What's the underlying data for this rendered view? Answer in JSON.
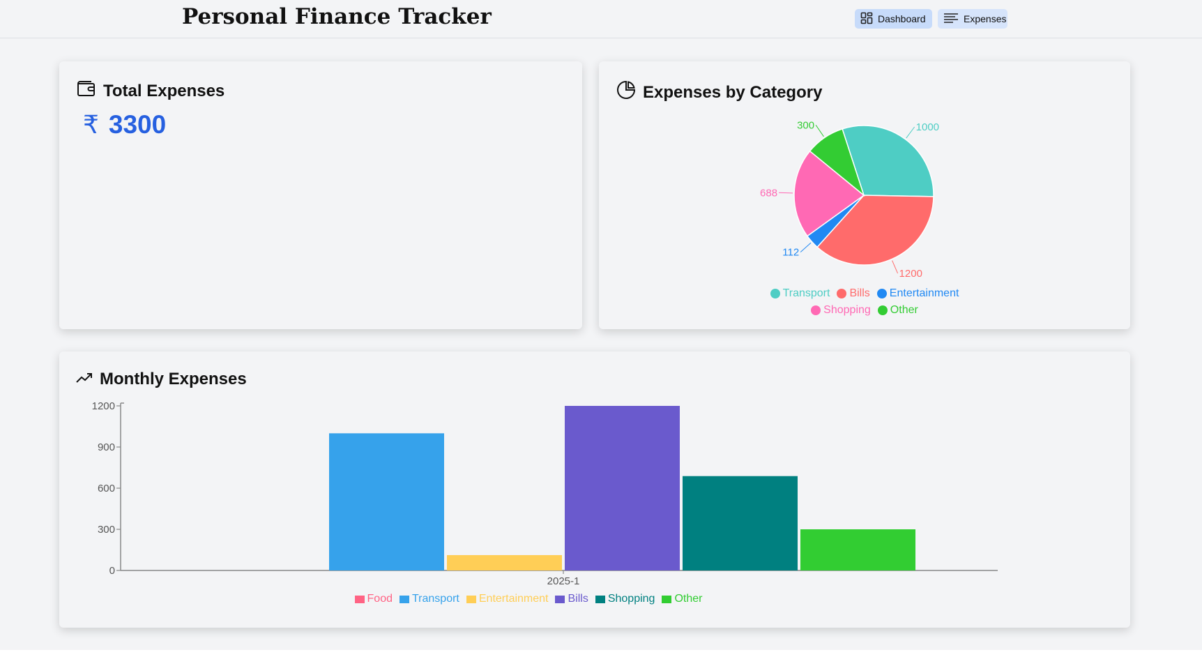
{
  "app": {
    "title": "Personal Finance Tracker"
  },
  "nav": [
    {
      "label": "Dashboard",
      "icon": "dashboard-grid-icon",
      "active": true
    },
    {
      "label": "Expenses",
      "icon": "list-icon",
      "active": false
    }
  ],
  "total": {
    "title": "Total Expenses",
    "icon": "wallet-icon",
    "currency": "₹",
    "amount": "3300"
  },
  "pie_card": {
    "title": "Expenses by Category",
    "icon": "pie-chart-icon"
  },
  "monthly_card": {
    "title": "Monthly Expenses",
    "icon": "trending-up-icon"
  },
  "chart_data": [
    {
      "type": "pie",
      "slices": [
        {
          "label": "Transport",
          "value": 1000,
          "color": "#4ecdc4"
        },
        {
          "label": "Bills",
          "value": 1200,
          "color": "#ff6b6b"
        },
        {
          "label": "Entertainment",
          "value": 112,
          "color": "#2189f3"
        },
        {
          "label": "Shopping",
          "value": 688,
          "color": "#ff69b4"
        },
        {
          "label": "Other",
          "value": 300,
          "color": "#33cc33"
        }
      ],
      "legend_position": "bottom"
    },
    {
      "type": "bar",
      "categories": [
        "2025-1"
      ],
      "series": [
        {
          "name": "Food",
          "values": [
            0
          ],
          "color": "#ff6384"
        },
        {
          "name": "Transport",
          "values": [
            1000
          ],
          "color": "#36a2eb"
        },
        {
          "name": "Entertainment",
          "values": [
            112
          ],
          "color": "#ffce56"
        },
        {
          "name": "Bills",
          "values": [
            1200
          ],
          "color": "#6a5acd"
        },
        {
          "name": "Shopping",
          "values": [
            688
          ],
          "color": "#008080"
        },
        {
          "name": "Other",
          "values": [
            300
          ],
          "color": "#32cd32"
        }
      ],
      "yticks": [
        0,
        300,
        600,
        900,
        1200
      ],
      "ylim": [
        0,
        1200
      ],
      "grid": false,
      "legend_position": "bottom"
    }
  ]
}
